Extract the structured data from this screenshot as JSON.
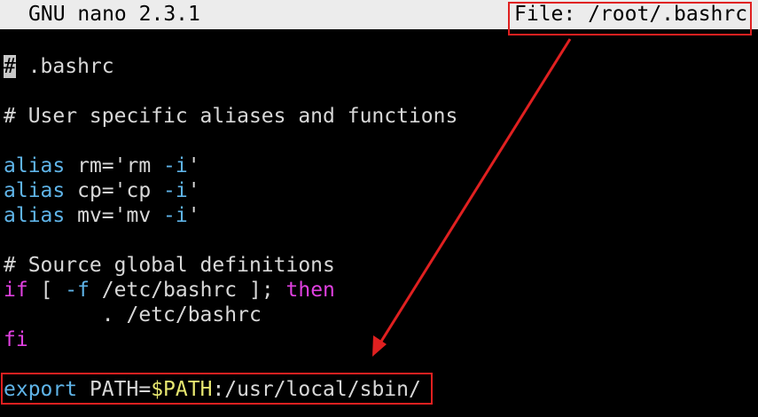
{
  "titlebar": {
    "app_name": "GNU nano 2.3.1",
    "file_label": "File: /root/.bashrc"
  },
  "editor": {
    "line1_hash": "#",
    "line1_text": " .bashrc",
    "line3_text": "# User specific aliases and functions",
    "aliases": [
      {
        "keyword": "alias",
        "pre": " rm='rm ",
        "flag": "-i",
        "post": "'"
      },
      {
        "keyword": "alias",
        "pre": " cp='cp ",
        "flag": "-i",
        "post": "'"
      },
      {
        "keyword": "alias",
        "pre": " mv='mv ",
        "flag": "-i",
        "post": "'"
      }
    ],
    "source_comment": "# Source global definitions",
    "if_kw": "if",
    "if_mid1": " [ ",
    "if_flag": "-f",
    "if_mid2": " /etc/bashrc ]; ",
    "then_kw": "then",
    "source_line": "        . /etc/bashrc",
    "fi_kw": "fi",
    "export_kw": "export",
    "export_mid": " PATH=",
    "export_var": "$PATH",
    "export_rest": ":/usr/local/sbin/"
  },
  "colors": {
    "keyword_blue": "#5fb4e8",
    "keyword_pink": "#e040e0",
    "variable_yellow": "#e8e870",
    "annotation_red": "#e02020"
  }
}
